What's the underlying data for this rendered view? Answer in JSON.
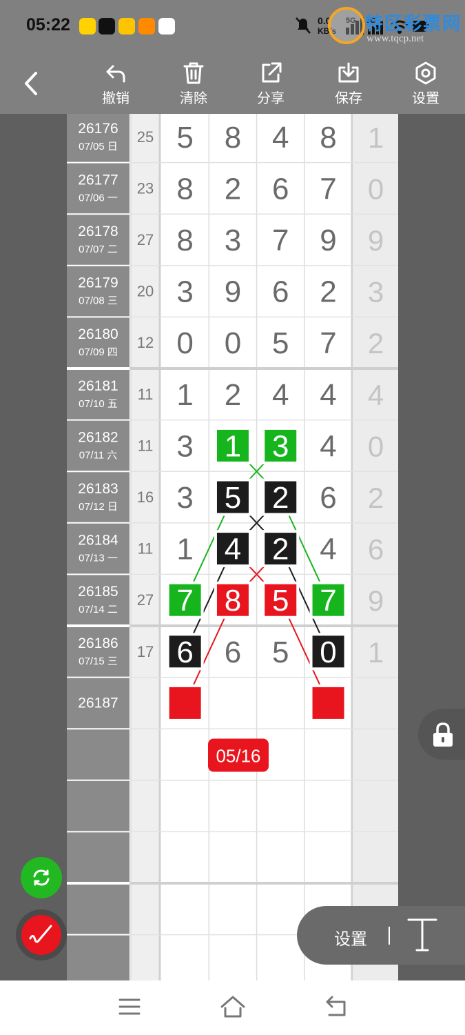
{
  "status_bar": {
    "time": "05:22",
    "app_icons": [
      "meituan-icon",
      "douyin-icon",
      "yellow-app-icon",
      "video-app-icon",
      "qq-icon"
    ],
    "net_speed_value": "0.0",
    "net_speed_unit": "KB/s",
    "network_5g_a": "5G",
    "network_5g_b": "5G",
    "icons": [
      "mute-icon",
      "signal-icon",
      "wifi-icon",
      "battery-icon"
    ]
  },
  "watermark": {
    "text": "特区彩票网",
    "url": "www.tqcp.net"
  },
  "toolbar": {
    "back_icon": "back-arrow-icon",
    "items": [
      {
        "label": "撤销",
        "icon": "undo-icon"
      },
      {
        "label": "清除",
        "icon": "trash-icon"
      },
      {
        "label": "分享",
        "icon": "share-icon"
      },
      {
        "label": "保存",
        "icon": "download-icon"
      },
      {
        "label": "设置",
        "icon": "settings-hex-icon"
      }
    ]
  },
  "table": {
    "rows": [
      {
        "issue": "26176",
        "date": "07/05 日",
        "sum": "25",
        "digits": [
          "5",
          "8",
          "4",
          "8"
        ],
        "extra": "1"
      },
      {
        "issue": "26177",
        "date": "07/06 一",
        "sum": "23",
        "digits": [
          "8",
          "2",
          "6",
          "7"
        ],
        "extra": "0"
      },
      {
        "issue": "26178",
        "date": "07/07 二",
        "sum": "27",
        "digits": [
          "8",
          "3",
          "7",
          "9"
        ],
        "extra": "9"
      },
      {
        "issue": "26179",
        "date": "07/08 三",
        "sum": "20",
        "digits": [
          "3",
          "9",
          "6",
          "2"
        ],
        "extra": "3"
      },
      {
        "issue": "26180",
        "date": "07/09 四",
        "sum": "12",
        "digits": [
          "0",
          "0",
          "5",
          "7"
        ],
        "extra": "2"
      },
      {
        "issue": "26181",
        "date": "07/10 五",
        "sum": "11",
        "digits": [
          "1",
          "2",
          "4",
          "4"
        ],
        "extra": "4"
      },
      {
        "issue": "26182",
        "date": "07/11 六",
        "sum": "11",
        "digits": [
          "3",
          "1",
          "3",
          "4"
        ],
        "extra": "0"
      },
      {
        "issue": "26183",
        "date": "07/12 日",
        "sum": "16",
        "digits": [
          "3",
          "5",
          "2",
          "6"
        ],
        "extra": "2"
      },
      {
        "issue": "26184",
        "date": "07/13 一",
        "sum": "11",
        "digits": [
          "1",
          "4",
          "2",
          "4"
        ],
        "extra": "6"
      },
      {
        "issue": "26185",
        "date": "07/14 二",
        "sum": "27",
        "digits": [
          "7",
          "8",
          "5",
          "7"
        ],
        "extra": "9"
      },
      {
        "issue": "26186",
        "date": "07/15 三",
        "sum": "17",
        "digits": [
          "6",
          "6",
          "5",
          "0"
        ],
        "extra": "1"
      },
      {
        "issue": "26187",
        "date": "",
        "sum": "",
        "digits": [
          "",
          "",
          "",
          ""
        ],
        "extra": ""
      },
      {
        "issue": "",
        "date": "",
        "sum": "",
        "digits": [
          "",
          "",
          "",
          ""
        ],
        "extra": ""
      },
      {
        "issue": "",
        "date": "",
        "sum": "",
        "digits": [
          "",
          "",
          "",
          ""
        ],
        "extra": ""
      },
      {
        "issue": "",
        "date": "",
        "sum": "",
        "digits": [
          "",
          "",
          "",
          ""
        ],
        "extra": ""
      },
      {
        "issue": "",
        "date": "",
        "sum": "",
        "digits": [
          "",
          "",
          "",
          ""
        ],
        "extra": ""
      },
      {
        "issue": "",
        "date": "",
        "sum": "",
        "digits": [
          "",
          "",
          "",
          ""
        ],
        "extra": ""
      }
    ],
    "highlights": [
      {
        "row": 6,
        "col": 1,
        "style": "green"
      },
      {
        "row": 6,
        "col": 2,
        "style": "green"
      },
      {
        "row": 7,
        "col": 1,
        "style": "black"
      },
      {
        "row": 7,
        "col": 2,
        "style": "black"
      },
      {
        "row": 8,
        "col": 1,
        "style": "black"
      },
      {
        "row": 8,
        "col": 2,
        "style": "black"
      },
      {
        "row": 9,
        "col": 0,
        "style": "green"
      },
      {
        "row": 9,
        "col": 1,
        "style": "red"
      },
      {
        "row": 9,
        "col": 2,
        "style": "red"
      },
      {
        "row": 9,
        "col": 3,
        "style": "green"
      },
      {
        "row": 10,
        "col": 0,
        "style": "black"
      },
      {
        "row": 10,
        "col": 3,
        "style": "black"
      },
      {
        "row": 11,
        "col": 0,
        "style": "red-empty"
      },
      {
        "row": 11,
        "col": 3,
        "style": "red-empty"
      }
    ],
    "links": [
      {
        "from": [
          6,
          1
        ],
        "to": [
          7,
          2
        ],
        "color": "green"
      },
      {
        "from": [
          6,
          2
        ],
        "to": [
          7,
          1
        ],
        "color": "green"
      },
      {
        "from": [
          7,
          1
        ],
        "to": [
          8,
          2
        ],
        "color": "black"
      },
      {
        "from": [
          7,
          2
        ],
        "to": [
          8,
          1
        ],
        "color": "black"
      },
      {
        "from": [
          8,
          1
        ],
        "to": [
          9,
          2
        ],
        "color": "red"
      },
      {
        "from": [
          8,
          2
        ],
        "to": [
          9,
          1
        ],
        "color": "red"
      },
      {
        "from": [
          7,
          1
        ],
        "to": [
          9,
          0
        ],
        "color": "green"
      },
      {
        "from": [
          7,
          2
        ],
        "to": [
          9,
          3
        ],
        "color": "green"
      },
      {
        "from": [
          8,
          1
        ],
        "to": [
          10,
          0
        ],
        "color": "black"
      },
      {
        "from": [
          8,
          2
        ],
        "to": [
          10,
          3
        ],
        "color": "black"
      },
      {
        "from": [
          9,
          1
        ],
        "to": [
          11,
          0
        ],
        "color": "red"
      },
      {
        "from": [
          9,
          2
        ],
        "to": [
          11,
          3
        ],
        "color": "red"
      }
    ],
    "date_badge": "05/16",
    "colors": {
      "green": "#17b51d",
      "black": "#1c1c1c",
      "red": "#e8141e"
    }
  },
  "floating": {
    "lock_icon": "lock-icon",
    "sync_icon": "sync-icon",
    "pen_icon": "pen-icon",
    "pill_label": "设置",
    "pill_icon": "text-T-icon"
  },
  "nav": {
    "icons": [
      "menu-icon",
      "home-icon",
      "return-icon"
    ]
  }
}
